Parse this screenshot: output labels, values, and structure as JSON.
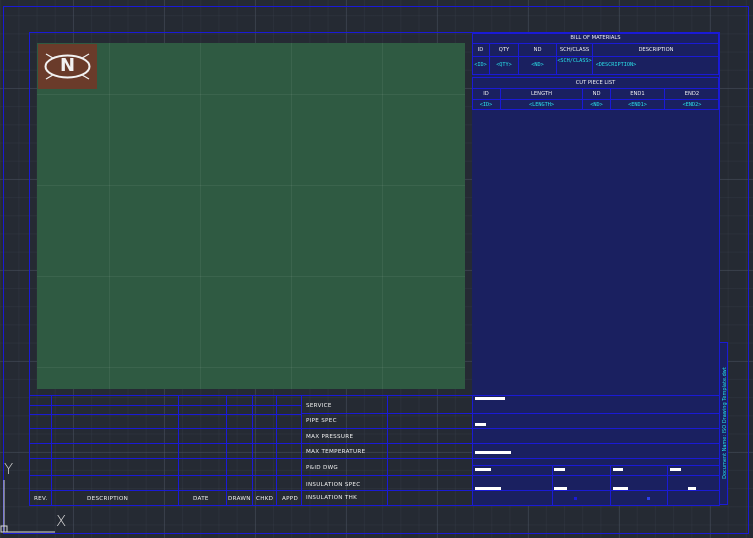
{
  "colors": {
    "background": "#252a33",
    "frame": "#1a1ad6",
    "panel": "#1a2060",
    "viewport": "#2f5a42",
    "logo_bg": "#6a3b2a",
    "text_white": "#f2f2f2",
    "text_cyan": "#29e0e8"
  },
  "logo": {
    "letter": "N",
    "icon": "logo-n-icon"
  },
  "bom": {
    "title": "BILL OF MATERIALS",
    "headers": [
      "ID",
      "QTY",
      "ND",
      "SCH/CLASS",
      "DESCRIPTION"
    ],
    "values": [
      "<ID>",
      "<QTY>",
      "<ND>",
      "<SCH/CLASS>",
      "<DESCRIPTION>"
    ]
  },
  "cut_list": {
    "title": "CUT PIECE LIST",
    "headers": [
      "ID",
      "LENGTH",
      "ND",
      "END1",
      "END2"
    ],
    "values": [
      "<ID>",
      "<LENGTH>",
      "<ND>",
      "<END1>",
      "<END2>"
    ]
  },
  "revision_table": {
    "headers": [
      "REV.",
      "DESCRIPTION",
      "DATE",
      "DRAWN",
      "CHKD",
      "APPD"
    ]
  },
  "info_labels": [
    "SERVICE",
    "PIPE SPEC",
    "MAX PRESSURE",
    "MAX TEMPERATURE",
    "P&ID DWG",
    "INSULATION SPEC",
    "INSULATION THK"
  ],
  "side_note": "Document Name: ISO Drawing Template.dwt",
  "axes": {
    "x_label": "X",
    "y_label": "Y"
  }
}
